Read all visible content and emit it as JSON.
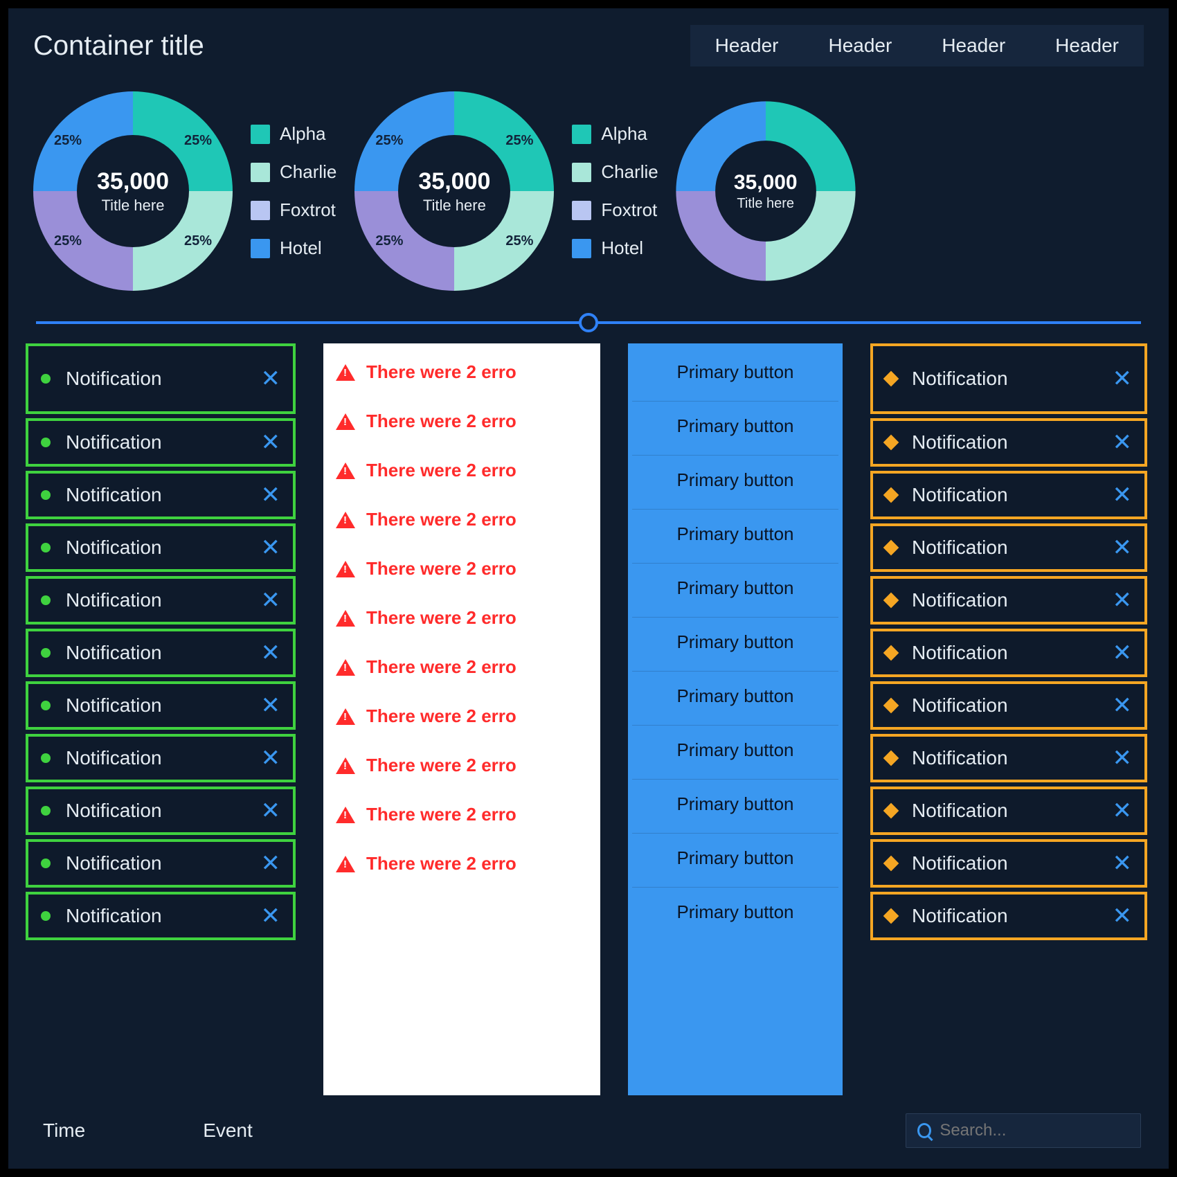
{
  "container_title": "Container title",
  "header_tabs": [
    "Header",
    "Header",
    "Header",
    "Header"
  ],
  "legend": [
    {
      "label": "Alpha",
      "color": "#1fc7b6"
    },
    {
      "label": "Charlie",
      "color": "#a9e7d9"
    },
    {
      "label": "Foxtrot",
      "color": "#b9c6f2"
    },
    {
      "label": "Hotel",
      "color": "#3a97f0"
    }
  ],
  "donut": {
    "center_value": "35,000",
    "center_label": "Title here",
    "slice_label": "25%"
  },
  "chart_data": [
    {
      "type": "pie",
      "title": "Title here",
      "center_value": 35000,
      "series": [
        {
          "name": "Alpha",
          "value": 25,
          "color": "#1fc7b6"
        },
        {
          "name": "Charlie",
          "value": 25,
          "color": "#a9e7d9"
        },
        {
          "name": "Foxtrot",
          "value": 25,
          "color": "#b9c6f2"
        },
        {
          "name": "Hotel",
          "value": 25,
          "color": "#3a97f0"
        }
      ]
    },
    {
      "type": "pie",
      "title": "Title here",
      "center_value": 35000,
      "series": [
        {
          "name": "Alpha",
          "value": 25,
          "color": "#1fc7b6"
        },
        {
          "name": "Charlie",
          "value": 25,
          "color": "#a9e7d9"
        },
        {
          "name": "Foxtrot",
          "value": 25,
          "color": "#b9c6f2"
        },
        {
          "name": "Hotel",
          "value": 25,
          "color": "#3a97f0"
        }
      ]
    },
    {
      "type": "pie",
      "title": "Title here",
      "center_value": 35000,
      "series": [
        {
          "name": "Alpha",
          "value": 25,
          "color": "#1fc7b6"
        },
        {
          "name": "Charlie",
          "value": 25,
          "color": "#a9e7d9"
        },
        {
          "name": "Foxtrot",
          "value": 25,
          "color": "#b9c6f2"
        },
        {
          "name": "Hotel",
          "value": 25,
          "color": "#3a97f0"
        }
      ]
    }
  ],
  "slider_position_pct": 50,
  "col_green": {
    "label": "Notification",
    "count": 11
  },
  "col_red": {
    "text": "There were 2 erro",
    "count": 11
  },
  "col_blue": {
    "label": "Primary button",
    "count": 11
  },
  "col_orange": {
    "label": "Notification",
    "count": 11
  },
  "bottom": {
    "col1": "Time",
    "col2": "Event",
    "search_placeholder": "Search..."
  }
}
